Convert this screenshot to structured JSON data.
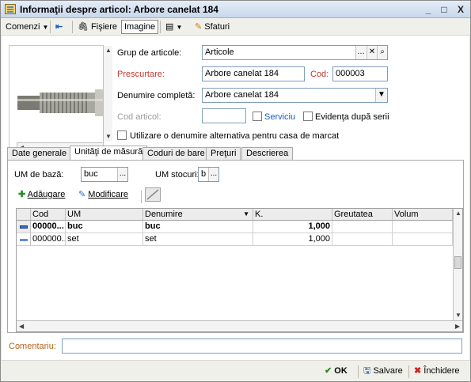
{
  "window": {
    "title": "Informaţii despre articol: Arbore canelat 184",
    "controls": [
      "_",
      "□",
      "X"
    ]
  },
  "toolbar": {
    "comenzi": "Comenzi",
    "fisiere": "Fişiere",
    "imagine": "Imagine",
    "sfaturi": "Sfaturi"
  },
  "form": {
    "grup_label": "Grup de articole:",
    "grup_value": "Articole",
    "prescurtare_label": "Prescurtare:",
    "prescurtare_value": "Arbore canelat 184",
    "cod_label": "Cod:",
    "cod_value": "000003",
    "denumire_label": "Denumire completă:",
    "denumire_value": "Arbore canelat 184",
    "cod_articol_label": "Cod articol:",
    "cod_articol_value": "",
    "serviciu_label": "Serviciu",
    "evidenta_label": "Evidenţa după serii",
    "alternativa_label": "Utilizare o denumire alternativa pentru casa de marcat"
  },
  "tabs": [
    {
      "label": "Date generale"
    },
    {
      "label": "Unităţi de măsură"
    },
    {
      "label": "Coduri de bare"
    },
    {
      "label": "Preţuri"
    },
    {
      "label": "Descrierea"
    }
  ],
  "um": {
    "baza_label": "UM de bază:",
    "baza_value": "buc",
    "stocuri_label": "UM stocuri:",
    "stocuri_value": "b",
    "ellipsis": "..."
  },
  "actions": {
    "adaugare": "Adăugare",
    "modificare": "Modificare"
  },
  "table": {
    "columns": [
      "Cod",
      "UM",
      "Denumire",
      "K.",
      "Greutatea",
      "Volum"
    ],
    "rows": [
      {
        "cod": "00000...",
        "um": "buc",
        "denumire": "buc",
        "k": "1,000",
        "greutatea": "",
        "volum": ""
      },
      {
        "cod": "000000...",
        "um": "set",
        "denumire": "set",
        "k": "1,000",
        "greutatea": "",
        "volum": ""
      }
    ]
  },
  "comentariu_label": "Comentariu:",
  "comentariu_value": "",
  "buttons": {
    "ok": "OK",
    "salvare": "Salvare",
    "inchidere": "Închidere"
  },
  "colors": {
    "required_label": "#c0392b",
    "title_bg": "#c9d8ec",
    "selected_marker": "#3b6fc7"
  }
}
